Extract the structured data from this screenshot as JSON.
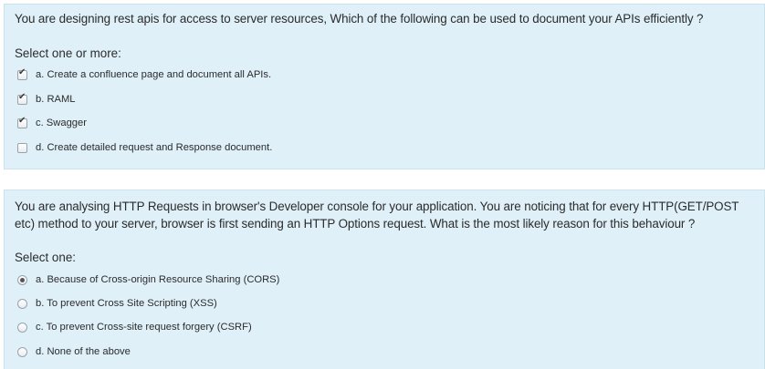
{
  "questions": [
    {
      "text": "You are designing rest apis for access to server resources, Which of the following can be used to document your APIs efficiently ?",
      "prompt": "Select one or more:",
      "input_type": "checkbox",
      "options": [
        {
          "label": "a. Create a confluence page and document all APIs.",
          "checked": true
        },
        {
          "label": "b. RAML",
          "checked": true
        },
        {
          "label": "c. Swagger",
          "checked": true
        },
        {
          "label": "d. Create detailed request and Response document.",
          "checked": false
        }
      ]
    },
    {
      "text": "You are analysing HTTP Requests in browser's Developer console for your application. You are noticing that for every HTTP(GET/POST etc) method to your server, browser is first sending an HTTP Options request. What is the most likely reason for this behaviour ?",
      "prompt": "Select one:",
      "input_type": "radio",
      "options": [
        {
          "label": "a. Because of Cross-origin Resource Sharing (CORS)",
          "checked": true
        },
        {
          "label": "b. To prevent Cross Site Scripting (XSS)",
          "checked": false
        },
        {
          "label": "c. To prevent Cross-site request forgery  (CSRF)",
          "checked": false
        },
        {
          "label": "d. None of the above",
          "checked": false
        }
      ]
    }
  ],
  "colors": {
    "panel_bg": "#dff0f8",
    "panel_border": "#c9e3ef",
    "text": "#2b2b2b"
  }
}
